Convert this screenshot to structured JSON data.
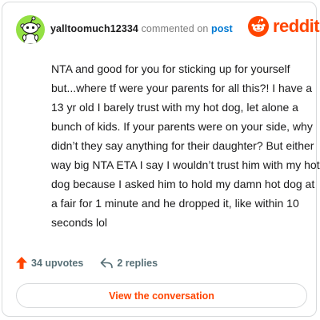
{
  "header": {
    "username": "yalltoomuch12334",
    "commented_text": "commented on",
    "post_link": "post",
    "logo_text": "reddit",
    "avatar_icon": "snoo-avatar-icon",
    "logo_icon": "reddit-alien-icon"
  },
  "comment": {
    "body": "NTA and good for you for sticking up for yourself but...where tf were your parents for all this?! I have a 13 yr old I barely trust with my hot dog, let alone a bunch of kids. If your parents were on your side, why didn’t they say anything for their daughter? But either way big NTA ETA I say I wouldn’t trust him with my hot dog because I asked him to hold my damn hot dog at a fair for 1 minute and he dropped it, like within 10 seconds lol"
  },
  "stats": {
    "upvotes": "34 upvotes",
    "replies": "2 replies",
    "upvote_icon": "upvote-arrow-icon",
    "reply_icon": "reply-arrow-icon"
  },
  "actions": {
    "view_conversation": "View the conversation"
  },
  "colors": {
    "brand": "#ff4500",
    "link": "#0079d3",
    "avatar_bg": "#94e044",
    "muted": "#576f76"
  }
}
